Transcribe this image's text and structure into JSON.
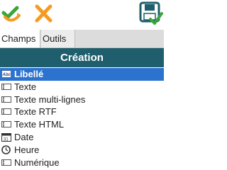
{
  "toolbar": {
    "validate_icon": "check-arrow-icon",
    "cancel_icon": "cross-icon",
    "save_icon": "save-check-icon"
  },
  "tabs": [
    {
      "label": "Champs",
      "active": true
    },
    {
      "label": "Outils",
      "active": false
    }
  ],
  "header": {
    "title": "Création"
  },
  "items": [
    {
      "label": "Libellé",
      "icon": "label-abc-icon",
      "selected": true
    },
    {
      "label": "Texte",
      "icon": "text-field-icon",
      "selected": false
    },
    {
      "label": "Texte multi-lignes",
      "icon": "text-field-icon",
      "selected": false
    },
    {
      "label": "Texte RTF",
      "icon": "text-field-icon",
      "selected": false
    },
    {
      "label": "Texte HTML",
      "icon": "text-field-icon",
      "selected": false
    },
    {
      "label": "Date",
      "icon": "calendar-icon",
      "selected": false
    },
    {
      "label": "Heure",
      "icon": "clock-icon",
      "selected": false
    },
    {
      "label": "Numérique",
      "icon": "text-field-icon",
      "selected": false
    }
  ],
  "colors": {
    "header_bg": "#1f5e6c",
    "selection_bg": "#2b73cf",
    "accent_orange": "#f59a23",
    "accent_green": "#3aa63a"
  }
}
